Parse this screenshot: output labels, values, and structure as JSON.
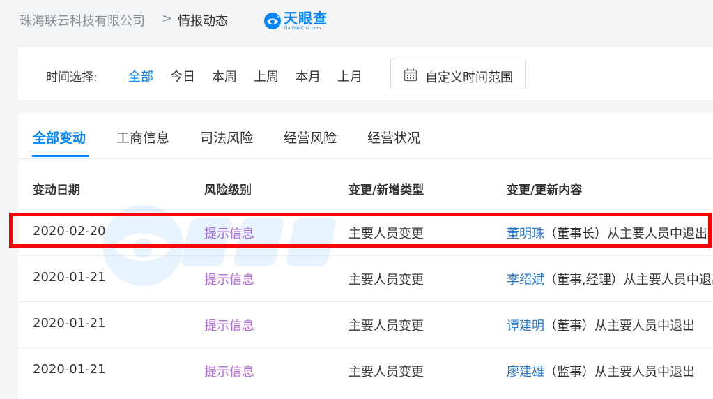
{
  "breadcrumb": {
    "company": "珠海联云科技有限公司",
    "separator": ">",
    "current": "情报动态"
  },
  "brand": {
    "name": "天眼查",
    "sub": "TianYanCha.com",
    "color": "#0084ff"
  },
  "time_filter": {
    "label": "时间选择:",
    "options": [
      "全部",
      "今日",
      "本周",
      "上周",
      "本月",
      "上月"
    ],
    "active": "全部",
    "custom_range": "自定义时间范围"
  },
  "tabs": {
    "items": [
      "全部变动",
      "工商信息",
      "司法风险",
      "经营风险",
      "经营状况"
    ],
    "active": "全部变动"
  },
  "table": {
    "headers": [
      "变动日期",
      "风险级别",
      "变更/新增类型",
      "变更/更新内容"
    ],
    "rows": [
      {
        "date": "2020-02-20",
        "risk": "提示信息",
        "type": "主要人员变更",
        "person": "董明珠",
        "detail": "（董事长）从主要人员中退出",
        "highlighted": true
      },
      {
        "date": "2020-01-21",
        "risk": "提示信息",
        "type": "主要人员变更",
        "person": "李绍斌",
        "detail": "（董事,经理）从主要人员中退出",
        "highlighted": false
      },
      {
        "date": "2020-01-21",
        "risk": "提示信息",
        "type": "主要人员变更",
        "person": "谭建明",
        "detail": "（董事）从主要人员中退出",
        "highlighted": false
      },
      {
        "date": "2020-01-21",
        "risk": "提示信息",
        "type": "主要人员变更",
        "person": "廖建雄",
        "detail": "（监事）从主要人员中退出",
        "highlighted": false
      }
    ]
  },
  "colors": {
    "accent": "#0084ff",
    "risk_text": "#b36bd6",
    "person_link": "#2a78c8",
    "highlight_border": "#ff0000"
  }
}
